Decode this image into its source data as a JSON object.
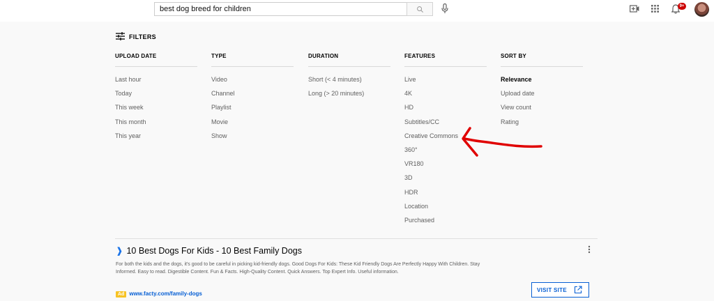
{
  "header": {
    "search_value": "best dog breed for children",
    "notifications_badge": "9+",
    "icons": {
      "search": "search-icon",
      "mic": "microphone-icon",
      "create": "create-video-icon",
      "apps": "apps-grid-icon",
      "notifications": "bell-icon"
    }
  },
  "filters": {
    "toggle_label": "FILTERS",
    "columns": [
      {
        "heading": "UPLOAD DATE",
        "options": [
          "Last hour",
          "Today",
          "This week",
          "This month",
          "This year"
        ]
      },
      {
        "heading": "TYPE",
        "options": [
          "Video",
          "Channel",
          "Playlist",
          "Movie",
          "Show"
        ]
      },
      {
        "heading": "DURATION",
        "options": [
          "Short (< 4 minutes)",
          "Long (> 20 minutes)"
        ]
      },
      {
        "heading": "FEATURES",
        "options": [
          "Live",
          "4K",
          "HD",
          "Subtitles/CC",
          "Creative Commons",
          "360°",
          "VR180",
          "3D",
          "HDR",
          "Location",
          "Purchased"
        ]
      },
      {
        "heading": "SORT BY",
        "options": [
          "Relevance",
          "Upload date",
          "View count",
          "Rating"
        ],
        "selected": "Relevance"
      }
    ]
  },
  "ad": {
    "title": "10 Best Dogs For Kids - 10 Best Family Dogs",
    "description": "For both the kids and the dogs, it's good to be careful in picking kid-friendly dogs. Good Dogs For Kids: These Kid Friendly Dogs Are Perfectly Happy With Children. Stay Informed. Easy to read. Digestible Content. Fun & Facts. High-Quality Content. Quick Answers. Top Expert Info. Useful information.",
    "badge": "Ad",
    "url": "www.facty.com/family-dogs",
    "visit_label": "VISIT SITE"
  },
  "colors": {
    "annotation": "#e00000",
    "link": "#065fd4",
    "ad_badge": "#f7c325"
  }
}
